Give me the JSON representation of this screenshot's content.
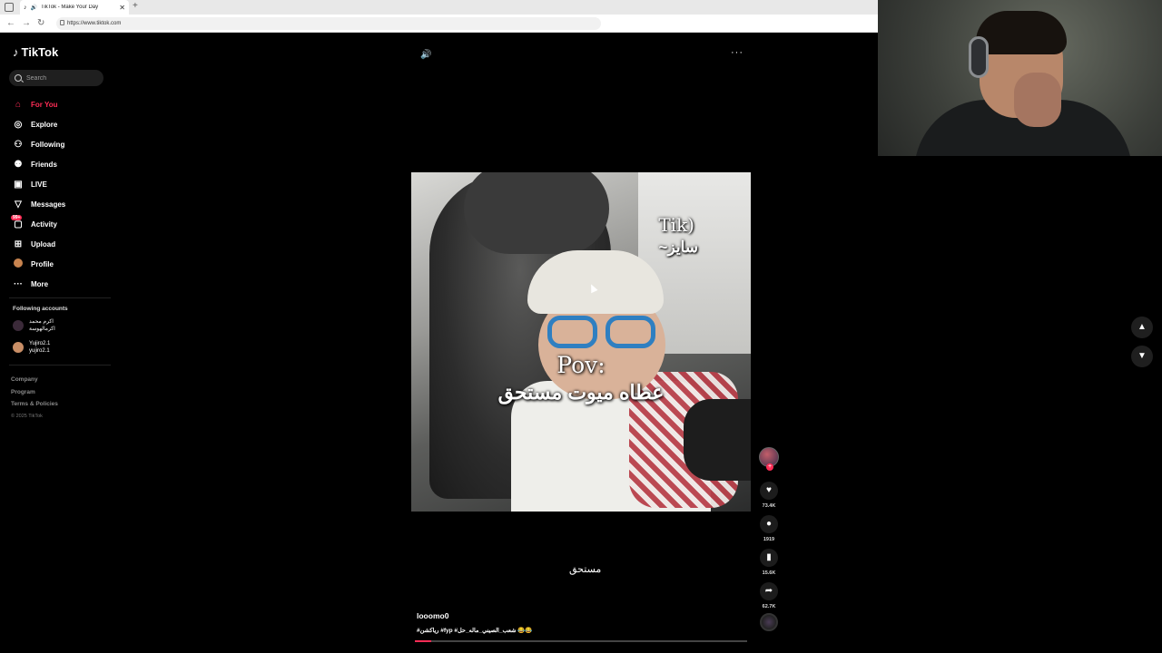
{
  "browser": {
    "tab_title": "TikTok - Make Your Day",
    "tab_close": "✕",
    "new_tab": "+",
    "url": "https://www.tiktok.com"
  },
  "sidebar": {
    "logo": "TikTok",
    "search_placeholder": "Search",
    "nav": [
      {
        "label": "For You",
        "icon": "home-icon",
        "active": true
      },
      {
        "label": "Explore",
        "icon": "compass-icon"
      },
      {
        "label": "Following",
        "icon": "following-icon"
      },
      {
        "label": "Friends",
        "icon": "friends-icon"
      },
      {
        "label": "LIVE",
        "icon": "live-icon"
      },
      {
        "label": "Messages",
        "icon": "messages-icon"
      },
      {
        "label": "Activity",
        "icon": "activity-icon",
        "badge": "99+"
      },
      {
        "label": "Upload",
        "icon": "upload-icon"
      },
      {
        "label": "Profile",
        "icon": "profile-icon"
      },
      {
        "label": "More",
        "icon": "more-icon"
      }
    ],
    "following_title": "Following accounts",
    "accounts": [
      {
        "name": "اكرم محمد",
        "handle": "اكرمالهوسة"
      },
      {
        "name": "Yujiro2.1",
        "handle": "yujiro2.1"
      }
    ],
    "footer": {
      "company": "Company",
      "program": "Program",
      "terms": "Terms & Policies",
      "copyright": "© 2025 TikTok"
    }
  },
  "video": {
    "overlay_tik": "Tik)",
    "overlay_saiz": "~سايز",
    "overlay_pov": "Pov:",
    "overlay_caption": "عطاه ميوت مستحق",
    "subtitle": "مستحق",
    "author": "looomo0",
    "description": "#رياكشن #fyp #شعب_الصيني_ماله_حل 😂😂",
    "progress": 0.05
  },
  "actions": {
    "likes": "73.4K",
    "comments": "1919",
    "saves": "15.6K",
    "shares": "62.7K"
  },
  "colors": {
    "accent": "#fe2c55",
    "background": "#000000"
  }
}
